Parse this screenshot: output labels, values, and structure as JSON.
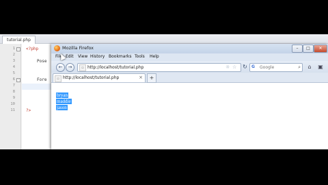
{
  "editor": {
    "tab_label": "tutorial.php",
    "line_numbers": [
      "1",
      "2",
      "3",
      "4",
      "5",
      "6",
      "7",
      "8",
      "9",
      "10",
      "11"
    ],
    "code_lines": [
      {
        "text": "<?php",
        "color": "#c0392b"
      },
      {
        "text": "",
        "color": "#333333"
      },
      {
        "text": "Pose",
        "color": "#333333"
      },
      {
        "text": "",
        "color": "#333333"
      },
      {
        "text": "",
        "color": "#333333"
      },
      {
        "text": "Fore",
        "color": "#333333"
      },
      {
        "text": "",
        "color": "#333333"
      },
      {
        "text": "",
        "color": "#333333"
      },
      {
        "text": "",
        "color": "#333333"
      },
      {
        "text": "?>",
        "color": "#c0392b"
      }
    ]
  },
  "firefox": {
    "title": "Mozilla Firefox",
    "window_buttons": {
      "minimize": "–",
      "maximize": "□",
      "close": "✕"
    },
    "menu": [
      "File",
      "Edit",
      "View",
      "History",
      "Bookmarks",
      "Tools",
      "Help"
    ],
    "url": "http://localhost/tutorial.php",
    "search_placeholder": "Google",
    "tab": {
      "label": "http://localhost/tutorial.php"
    },
    "page_output": [
      "bryan",
      "maddie",
      "jason"
    ],
    "selection_color": "#3399ff"
  }
}
